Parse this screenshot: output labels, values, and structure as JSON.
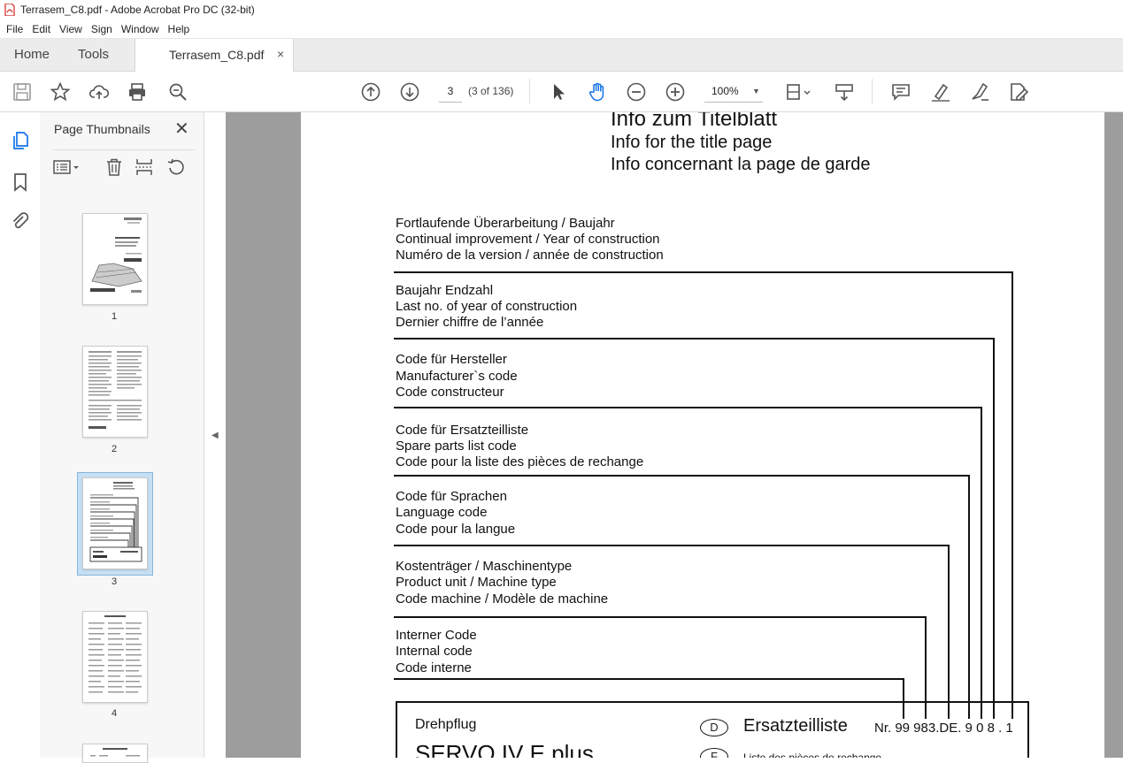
{
  "window": {
    "title": "Terrasem_C8.pdf - Adobe Acrobat Pro DC (32-bit)"
  },
  "menu": [
    "File",
    "Edit",
    "View",
    "Sign",
    "Window",
    "Help"
  ],
  "tabs": {
    "home": "Home",
    "tools": "Tools",
    "doc": "Terrasem_C8.pdf",
    "close": "×"
  },
  "toolbar": {
    "page_value": "3",
    "page_of": "(3 of 136)",
    "zoom": "100%",
    "zoom_caret": "▼"
  },
  "panel": {
    "title": "Page Thumbnails",
    "close": "✕",
    "thumb_labels": [
      "1",
      "2",
      "3",
      "4"
    ]
  },
  "doc": {
    "heading": [
      "Info  zum  Titelblatt",
      "Info for the title page",
      "Info concernant la page de garde"
    ],
    "groups": [
      [
        "Fortlaufende Überarbeitung / Baujahr",
        "Continual improvement / Year of construction",
        "Numéro de la version / année de construction"
      ],
      [
        "Baujahr Endzahl",
        "Last no. of year of construction",
        "Dernier chiffre de l’année"
      ],
      [
        "Code für Hersteller",
        "Manufacturer`s  code",
        "Code constructeur"
      ],
      [
        "Code für Ersatzteilliste",
        "Spare parts list code",
        "Code pour la liste des pièces de rechange"
      ],
      [
        "Code für Sprachen",
        "Language code",
        "Code pour la langue"
      ],
      [
        "Kostenträger / Maschinentype",
        "Product unit / Machine type",
        "Code machine / Modèle de machine"
      ],
      [
        "Interner Code",
        "Internal code",
        "Code interne"
      ]
    ],
    "box": {
      "product": "Drehpflug",
      "model": "SERVO IV E plus",
      "lang_d": "D",
      "lang_f": "F",
      "parts_list": "Ersatzteilliste",
      "number": "Nr. 99 983.DE. 9 0 8 . 1",
      "parts_list_fr": "Liste des pièces de rechange"
    }
  },
  "colors": {
    "accent": "#1473e6",
    "doc_bg": "#9d9d9d",
    "selection": "#c6dff2"
  }
}
